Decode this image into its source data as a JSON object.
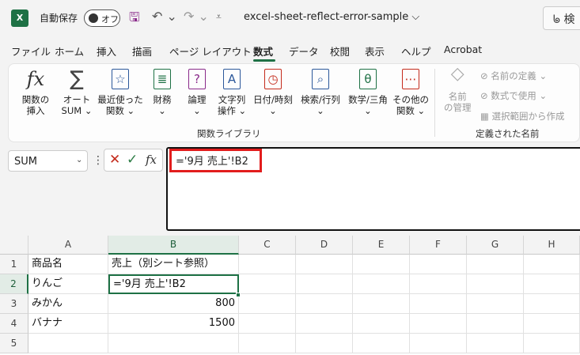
{
  "titlebar": {
    "autosave_label": "自動保存",
    "toggle_label": "オフ",
    "doc_title": "excel-sheet-reflect-error-sample",
    "title_chevron": "⌵",
    "search_glyph": "ᖚ 検"
  },
  "tabs": [
    "ファイル",
    "ホーム",
    "挿入",
    "描画",
    "ページ レイアウト",
    "数式",
    "データ",
    "校閲",
    "表示",
    "ヘルプ",
    "Acrobat"
  ],
  "active_tab": "数式",
  "ribbon": {
    "function_library": {
      "insert_function": [
        "関数の",
        "挿入"
      ],
      "autosum": [
        "オート",
        "SUM ⌄"
      ],
      "recent": [
        "最近使った",
        "関数 ⌄"
      ],
      "financial": [
        "財務",
        "⌄"
      ],
      "logical": [
        "論理",
        "⌄"
      ],
      "text": [
        "文字列",
        "操作 ⌄"
      ],
      "datetime": [
        "日付/時刻",
        "⌄"
      ],
      "lookup": [
        "検索/行列",
        "⌄"
      ],
      "math": [
        "数学/三角",
        "⌄"
      ],
      "more": [
        "その他の",
        "関数 ⌄"
      ],
      "group_label": "関数ライブラリ"
    },
    "defined_names": {
      "name_manager": [
        "名前",
        "の管理"
      ],
      "define_name": "名前の定義 ⌄",
      "use_in_formula": "数式で使用 ⌄",
      "create_from_selection": "選択範囲から作成",
      "group_label": "定義された名前"
    }
  },
  "formula_bar": {
    "name_box_value": "SUM",
    "formula": "='9月 売上'!B2"
  },
  "grid": {
    "columns": [
      "A",
      "B",
      "C",
      "D",
      "E",
      "F",
      "G",
      "H"
    ],
    "rows": [
      "1",
      "2",
      "3",
      "4",
      "5"
    ],
    "cells": {
      "A1": "商品名",
      "B1": "売上（別シート参照）",
      "A2": "りんご",
      "B2": "='9月 売上'!B2",
      "A3": "みかん",
      "B3": "800",
      "A4": "バナナ",
      "B4": "1500"
    },
    "active_cell": "B2"
  },
  "colors": {
    "excel_green": "#1e7145",
    "highlight_red": "#e21d1d"
  }
}
